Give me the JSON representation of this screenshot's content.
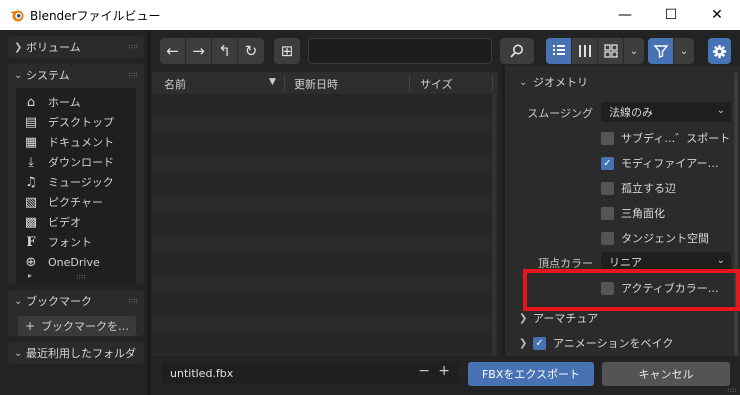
{
  "window": {
    "title": "Blenderファイルビュー",
    "minimize": "—",
    "maximize": "☐",
    "close": "✕"
  },
  "sidebar": {
    "volumes": {
      "label": "ボリューム"
    },
    "system": {
      "label": "システム",
      "items": [
        {
          "label": "ホーム",
          "icon": "home-icon",
          "glyph": "⌂"
        },
        {
          "label": "デスクトップ",
          "icon": "desktop-icon",
          "glyph": "▤"
        },
        {
          "label": "ドキュメント",
          "icon": "documents-icon",
          "glyph": "▦"
        },
        {
          "label": "ダウンロード",
          "icon": "download-icon",
          "glyph": "⤓"
        },
        {
          "label": "ミュージック",
          "icon": "music-icon",
          "glyph": "♫"
        },
        {
          "label": "ピクチャー",
          "icon": "pictures-icon",
          "glyph": "▧"
        },
        {
          "label": "ビデオ",
          "icon": "video-icon",
          "glyph": "▩"
        },
        {
          "label": "フォント",
          "icon": "font-icon",
          "glyph": "F"
        },
        {
          "label": "OneDrive",
          "icon": "network-icon",
          "glyph": "⊕"
        }
      ]
    },
    "bookmarks": {
      "label": "ブックマーク",
      "add_button": "ブックマークを…"
    },
    "recent": {
      "label": "最近利用したフォルダ"
    }
  },
  "toolbar": {
    "back": "←",
    "forward": "→",
    "parent": "↰",
    "refresh": "↻",
    "new_folder": "⊞",
    "path_value": "",
    "search_icon": "search-icon",
    "view_modes": [
      "list-vertical-icon",
      "list-horizontal-icon",
      "thumbnails-icon"
    ],
    "filter_icon": "filter-icon",
    "settings_icon": "gear-icon"
  },
  "file_list": {
    "columns": {
      "name": "名前",
      "date": "更新日時",
      "size": "サイズ"
    },
    "sort_indicator": "▼",
    "rows": []
  },
  "settings": {
    "geometry": {
      "header": "ジオメトリ",
      "smoothing_label": "スムージング",
      "smoothing_value": "法線のみ",
      "options": [
        {
          "label": "サブディ…゛スポート",
          "checked": false
        },
        {
          "label": "モディファイアー…",
          "checked": true
        },
        {
          "label": "孤立する辺",
          "checked": false
        },
        {
          "label": "三角面化",
          "checked": false
        },
        {
          "label": "タンジェント空間",
          "checked": false
        }
      ],
      "vertex_color_label": "頂点カラー",
      "vertex_color_value": "リニア",
      "active_color_label": "アクティブカラー…",
      "active_color_checked": false
    },
    "armature": {
      "header": "アーマチュア"
    },
    "bake_animation": {
      "header": "アニメーションをベイク",
      "checked": true
    }
  },
  "bottom": {
    "filename": "untitled.fbx",
    "decrement": "−",
    "increment": "+",
    "export_button": "FBXをエクスポート",
    "cancel_button": "キャンセル"
  },
  "colors": {
    "accent": "#4772b3",
    "highlight": "#e8141e"
  }
}
